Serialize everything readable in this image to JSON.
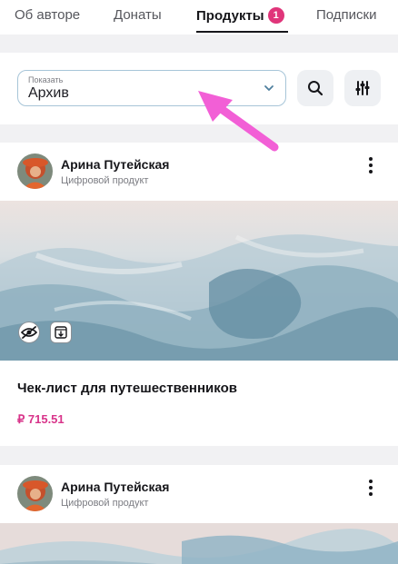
{
  "tabs": [
    {
      "label": "Об авторе"
    },
    {
      "label": "Донаты"
    },
    {
      "label": "Продукты",
      "badge": "1",
      "active": true
    },
    {
      "label": "Подписки"
    }
  ],
  "filter": {
    "select_label": "Показать",
    "select_value": "Архив"
  },
  "posts": [
    {
      "author": "Арина Путейская",
      "type": "Цифровой продукт",
      "title": "Чек-лист для путешественников",
      "price": "₽ 715.51"
    },
    {
      "author": "Арина Путейская",
      "type": "Цифровой продукт"
    }
  ],
  "colors": {
    "accent": "#d8348a",
    "badge": "#e0357a",
    "arrow": "#f25fd6"
  },
  "icons": [
    "search-icon",
    "filter-sliders-icon",
    "chevron-down-icon",
    "more-vertical-icon",
    "eye-off-icon",
    "download-icon"
  ]
}
